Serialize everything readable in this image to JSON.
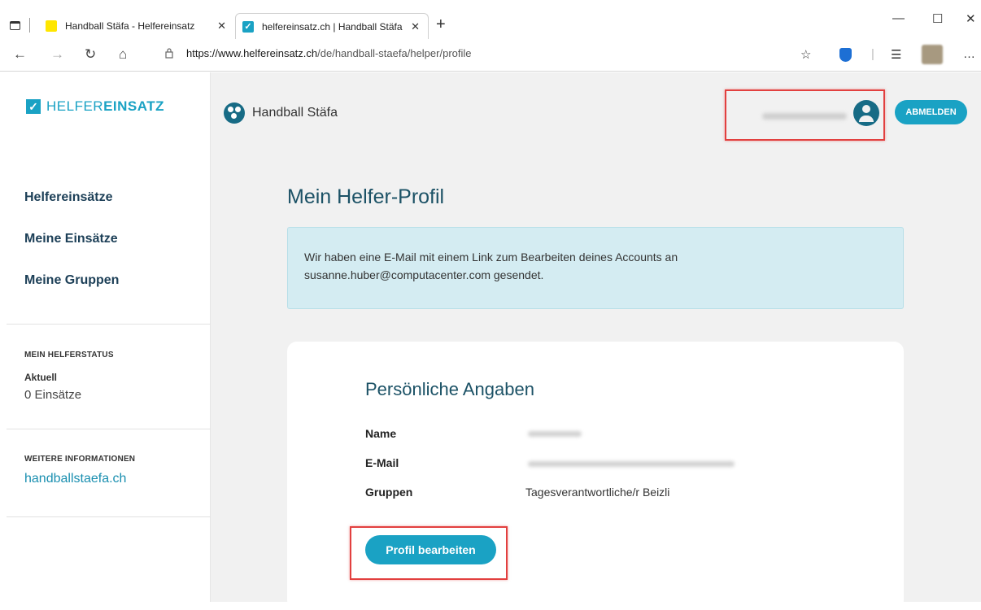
{
  "browser": {
    "tabs": [
      {
        "title": "Handball Stäfa - Helfereinsatz"
      },
      {
        "title": "helfereinsatz.ch | Handball Stäfa"
      }
    ],
    "url_domain": "https://www.helfereinsatz.ch",
    "url_path": "/de/handball-staefa/helper/profile",
    "icons": [
      "tab-actions-icon",
      "back-icon",
      "forward-icon",
      "reload-icon",
      "home-icon",
      "lock-icon",
      "favorite-add-icon",
      "extension-shield-icon",
      "favorites-icon",
      "profile-avatar-icon",
      "more-icon",
      "minimize-icon",
      "maximize-icon",
      "close-window-icon"
    ]
  },
  "sidebar": {
    "logo_light": "HELFER",
    "logo_bold": "EINSATZ",
    "nav": [
      "Helfereinsätze",
      "Meine Einsätze",
      "Meine Gruppen"
    ],
    "status_heading": "MEIN HELFERSTATUS",
    "status_label": "Aktuell",
    "status_value": "0 Einsätze",
    "info_heading": "WEITERE INFORMATIONEN",
    "info_link": "handballstaefa.ch"
  },
  "header": {
    "org_name": "Handball Stäfa",
    "logout_label": "ABMELDEN"
  },
  "main": {
    "title": "Mein Helfer-Profil",
    "info_line1": "Wir haben eine E-Mail mit einem Link zum Bearbeiten deines Accounts an",
    "info_line2": "susanne.huber@computacenter.com gesendet.",
    "card_title": "Persönliche Angaben",
    "labels": {
      "name": "Name",
      "email": "E-Mail",
      "groups": "Gruppen"
    },
    "groups_value": "Tagesverantwortliche/r Beizli",
    "edit_label": "Profil bearbeiten"
  },
  "colors": {
    "accent": "#1aa2c4",
    "dark": "#1c5266",
    "highlight": "#e2403f",
    "info_bg": "#d4ecf2"
  }
}
